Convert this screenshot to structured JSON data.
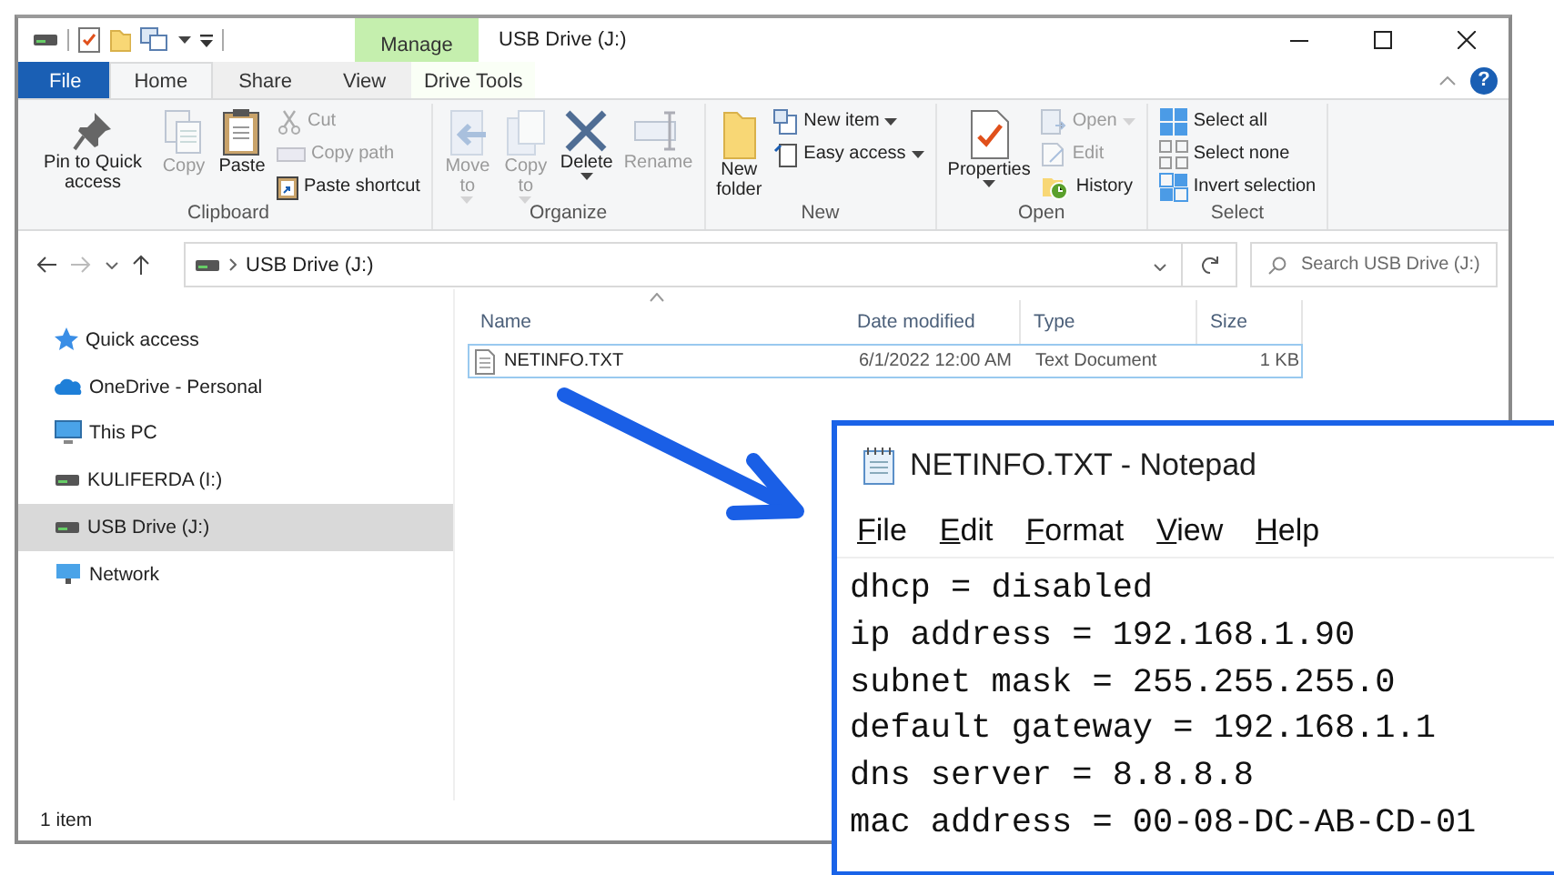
{
  "window": {
    "title": "USB Drive (J:)",
    "contextual_tab": "Manage"
  },
  "help_button": {
    "label": "?"
  },
  "ribbon_tabs": [
    {
      "label": "File",
      "kind": "file",
      "selected": false
    },
    {
      "label": "Home",
      "kind": "tab",
      "selected": true
    },
    {
      "label": "Share",
      "kind": "tab",
      "selected": false
    },
    {
      "label": "View",
      "kind": "tab",
      "selected": false
    },
    {
      "label": "Drive Tools",
      "kind": "contextual",
      "selected": false
    }
  ],
  "ribbon_groups": [
    {
      "label": "Clipboard",
      "items": [
        {
          "kind": "large",
          "label": "Pin to Quick access",
          "disabled": false,
          "dropdown": false
        },
        {
          "kind": "large",
          "label": "Copy",
          "disabled": true,
          "dropdown": false
        },
        {
          "kind": "large",
          "label": "Paste",
          "disabled": false,
          "dropdown": false
        },
        {
          "kind": "stack",
          "commands": [
            {
              "label": "Cut",
              "disabled": true,
              "dropdown": false
            },
            {
              "label": "Copy path",
              "disabled": true,
              "dropdown": false
            },
            {
              "label": "Paste shortcut",
              "disabled": false,
              "dropdown": false
            }
          ]
        }
      ]
    },
    {
      "label": "Organize",
      "items": [
        {
          "kind": "large",
          "label": "Move to",
          "disabled": true,
          "dropdown": true
        },
        {
          "kind": "large",
          "label": "Copy to",
          "disabled": true,
          "dropdown": true
        },
        {
          "kind": "large",
          "label": "Delete",
          "disabled": false,
          "dropdown": true
        },
        {
          "kind": "large",
          "label": "Rename",
          "disabled": true,
          "dropdown": false
        }
      ]
    },
    {
      "label": "New",
      "items": [
        {
          "kind": "large",
          "label": "New folder",
          "disabled": false,
          "dropdown": false
        },
        {
          "kind": "stack",
          "commands": [
            {
              "label": "New item",
              "disabled": false,
              "dropdown": true
            },
            {
              "label": "Easy access",
              "disabled": false,
              "dropdown": true
            }
          ]
        }
      ]
    },
    {
      "label": "Open",
      "items": [
        {
          "kind": "large",
          "label": "Properties",
          "disabled": false,
          "dropdown": true
        },
        {
          "kind": "stack",
          "commands": [
            {
              "label": "Open",
              "disabled": true,
              "dropdown": true
            },
            {
              "label": "Edit",
              "disabled": true,
              "dropdown": false
            },
            {
              "label": "History",
              "disabled": false,
              "dropdown": false
            }
          ]
        }
      ]
    },
    {
      "label": "Select",
      "items": [
        {
          "kind": "stack",
          "commands": [
            {
              "label": "Select all",
              "disabled": false,
              "dropdown": false
            },
            {
              "label": "Select none",
              "disabled": false,
              "dropdown": false
            },
            {
              "label": "Invert selection",
              "disabled": false,
              "dropdown": false
            }
          ]
        }
      ]
    }
  ],
  "address_bar": {
    "path": "USB Drive (J:)"
  },
  "search": {
    "placeholder": "Search USB Drive (J:)"
  },
  "navigation_pane": [
    {
      "label": "Quick access",
      "selected": false
    },
    {
      "label": "OneDrive - Personal",
      "selected": false
    },
    {
      "label": "This PC",
      "selected": false
    },
    {
      "label": "KULIFERDA (I:)",
      "selected": false
    },
    {
      "label": "USB Drive (J:)",
      "selected": true
    },
    {
      "label": "Network",
      "selected": false
    }
  ],
  "file_list": {
    "columns": [
      "Name",
      "Date modified",
      "Type",
      "Size"
    ],
    "rows": [
      {
        "cells": [
          "NETINFO.TXT",
          "6/1/2022 12:00 AM",
          "Text Document",
          "1 KB"
        ],
        "selected": true
      }
    ]
  },
  "status_bar": {
    "item_count": "1 item"
  },
  "notepad": {
    "title": "NETINFO.TXT - Notepad",
    "menu": [
      "File",
      "Edit",
      "Format",
      "View",
      "Help"
    ],
    "lines": [
      "dhcp = disabled",
      "ip address = 192.168.1.90",
      "subnet mask = 255.255.255.0",
      "default gateway = 192.168.1.1",
      "dns server = 8.8.8.8",
      "mac address = 00-08-DC-AB-CD-01"
    ]
  }
}
